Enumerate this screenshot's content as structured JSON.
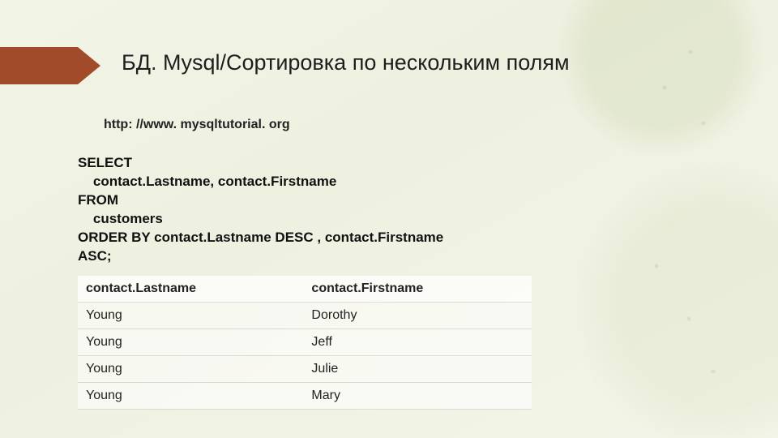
{
  "title": "БД. Mysql/Сортировка по нескольким полям",
  "source": "http: //www. mysqltutorial. org",
  "sql": {
    "l1": "SELECT",
    "l2": "    contact.Lastname, contact.Firstname",
    "l3": "FROM",
    "l4": "    customers",
    "l5": "ORDER BY contact.Lastname DESC , contact.Firstname",
    "l6": "ASC;"
  },
  "chart_data": {
    "type": "table",
    "columns": [
      "contact.Lastname",
      "contact.Firstname"
    ],
    "rows": [
      [
        "Young",
        "Dorothy"
      ],
      [
        "Young",
        "Jeff"
      ],
      [
        "Young",
        "Julie"
      ],
      [
        "Young",
        "Mary"
      ]
    ]
  }
}
